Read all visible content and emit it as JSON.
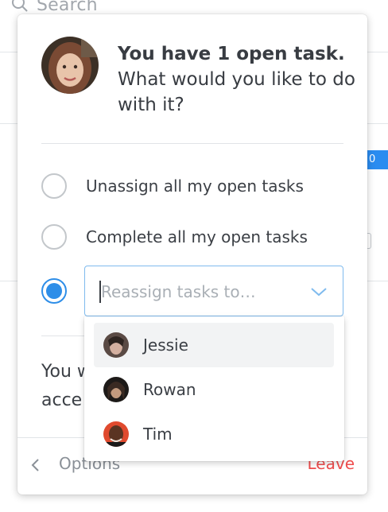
{
  "background": {
    "search_placeholder": "Search",
    "badge_text": "0",
    "accent": "#2a8cf0"
  },
  "dialog": {
    "avatar_icon": "user-avatar",
    "title_bold": "You have 1 open task.",
    "title_rest": "What would you like to do with it?",
    "options": [
      {
        "label": "Unassign all my open tasks",
        "checked": false
      },
      {
        "label": "Complete all my open tasks",
        "checked": false
      },
      {
        "label": "",
        "checked": true
      }
    ],
    "reassign_placeholder": "Reassign tasks to...",
    "reassign_text_visible": "Reassign tasks to…",
    "partial_text_line1": "You w",
    "partial_text_line2": "acce",
    "footer": {
      "back_label": "Options",
      "leave_label": "Leave",
      "leave_color": "#ef4d4d"
    },
    "radio_color": "#2e8ee8"
  },
  "dropdown": {
    "items": [
      {
        "name": "Jessie",
        "highlighted": true
      },
      {
        "name": "Rowan",
        "highlighted": false
      },
      {
        "name": "Tim",
        "highlighted": false
      }
    ]
  }
}
